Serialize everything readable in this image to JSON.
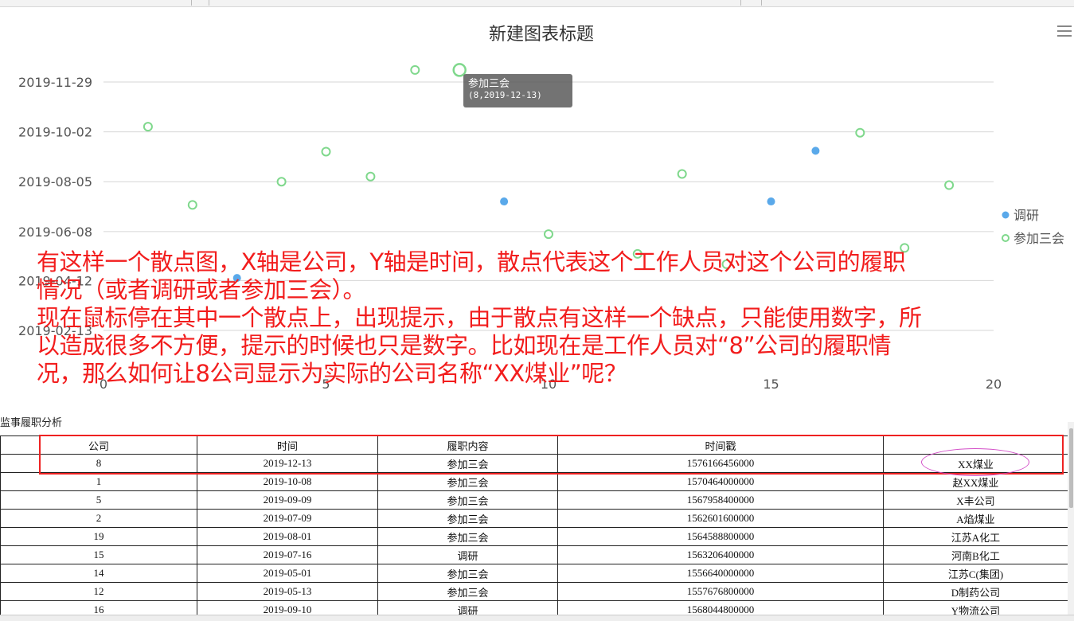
{
  "chart_data": {
    "type": "scatter",
    "title": "新建图表标题",
    "x_ticks": [
      "0",
      "5",
      "10",
      "15",
      "20"
    ],
    "xlim": [
      0,
      20
    ],
    "y_ticks": [
      "2019-02-13",
      "2019-04-12",
      "2019-06-08",
      "2019-08-05",
      "2019-10-02",
      "2019-11-29"
    ],
    "ylim": [
      "2019-02-13",
      "2019-11-29"
    ],
    "grid": true,
    "legend_position": "right",
    "series": [
      {
        "name": "调研",
        "color": "#5aa9ea",
        "marker": "filled-circle",
        "points": [
          {
            "x": 3,
            "y": "2019-04-15"
          },
          {
            "x": 9,
            "y": "2019-07-13"
          },
          {
            "x": 15,
            "y": "2019-07-13"
          },
          {
            "x": 16,
            "y": "2019-09-10"
          }
        ]
      },
      {
        "name": "参加三会",
        "color": "#7fd88c",
        "marker": "hollow-circle",
        "points": [
          {
            "x": 1,
            "y": "2019-10-08"
          },
          {
            "x": 2,
            "y": "2019-07-09"
          },
          {
            "x": 4,
            "y": "2019-08-05"
          },
          {
            "x": 5,
            "y": "2019-09-09"
          },
          {
            "x": 6,
            "y": "2019-08-11"
          },
          {
            "x": 7,
            "y": "2019-12-13"
          },
          {
            "x": 8,
            "y": "2019-12-13"
          },
          {
            "x": 10,
            "y": "2019-06-05"
          },
          {
            "x": 12,
            "y": "2019-05-13"
          },
          {
            "x": 13,
            "y": "2019-08-14"
          },
          {
            "x": 14,
            "y": "2019-05-01"
          },
          {
            "x": 17,
            "y": "2019-10-01"
          },
          {
            "x": 18,
            "y": "2019-05-20"
          },
          {
            "x": 19,
            "y": "2019-08-01"
          }
        ]
      }
    ]
  },
  "tooltip": {
    "series": "参加三会",
    "value": "(8,2019-12-13)"
  },
  "overlay": {
    "lines": [
      "有这样一个散点图，X轴是公司，Y轴是时间，散点代表这个工作人员对这个公司的履职",
      "情况（或者调研或者参加三会）。",
      "现在鼠标停在其中一个散点上，出现提示，由于散点有这样一个缺点，只能使用数字，所",
      "以造成很多不方便，提示的时候也只是数字。比如现在是工作人员对“8”公司的履职情",
      "况，那么如何让8公司显示为实际的公司名称“XX煤业”呢？"
    ]
  },
  "section_label": "监事履职分析",
  "table": {
    "headers": [
      "公司",
      "时间",
      "履职内容",
      "时间戳",
      ""
    ],
    "rows": [
      [
        "8",
        "2019-12-13",
        "参加三会",
        "1576166456000",
        "XX煤业"
      ],
      [
        "1",
        "2019-10-08",
        "参加三会",
        "1570464000000",
        "赵XX煤业"
      ],
      [
        "5",
        "2019-09-09",
        "参加三会",
        "1567958400000",
        "X丰公司"
      ],
      [
        "2",
        "2019-07-09",
        "参加三会",
        "1562601600000",
        "A焰煤业"
      ],
      [
        "19",
        "2019-08-01",
        "参加三会",
        "1564588800000",
        "江苏A化工"
      ],
      [
        "15",
        "2019-07-16",
        "调研",
        "1563206400000",
        "河南B化工"
      ],
      [
        "14",
        "2019-05-01",
        "参加三会",
        "1556640000000",
        "江苏C(集团)"
      ],
      [
        "12",
        "2019-05-13",
        "参加三会",
        "1557676800000",
        "D制药公司"
      ],
      [
        "16",
        "2019-09-10",
        "调研",
        "1568044800000",
        "Y物流公司"
      ]
    ]
  }
}
